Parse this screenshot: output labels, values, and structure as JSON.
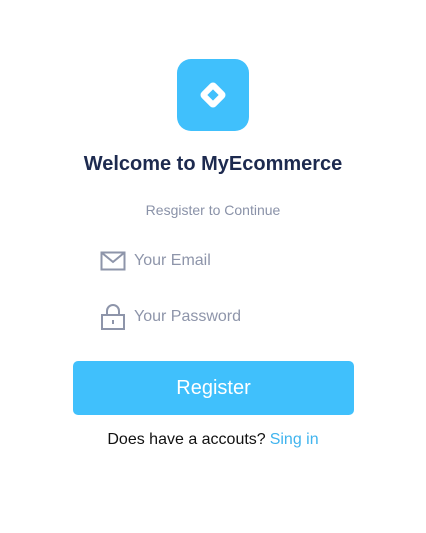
{
  "brand": {
    "logo_icon": "diamond-logo-icon",
    "accent_color": "#40c0fc"
  },
  "header": {
    "title": "Welcome to MyEcommerce",
    "subtitle": "Resgister to Continue"
  },
  "form": {
    "email": {
      "icon": "envelope-icon",
      "placeholder": "Your Email",
      "value": ""
    },
    "password": {
      "icon": "lock-icon",
      "placeholder": "Your Password",
      "value": ""
    },
    "submit_label": "Register"
  },
  "footer": {
    "prompt": "Does have a accouts?",
    "link_label": "Sing in"
  }
}
